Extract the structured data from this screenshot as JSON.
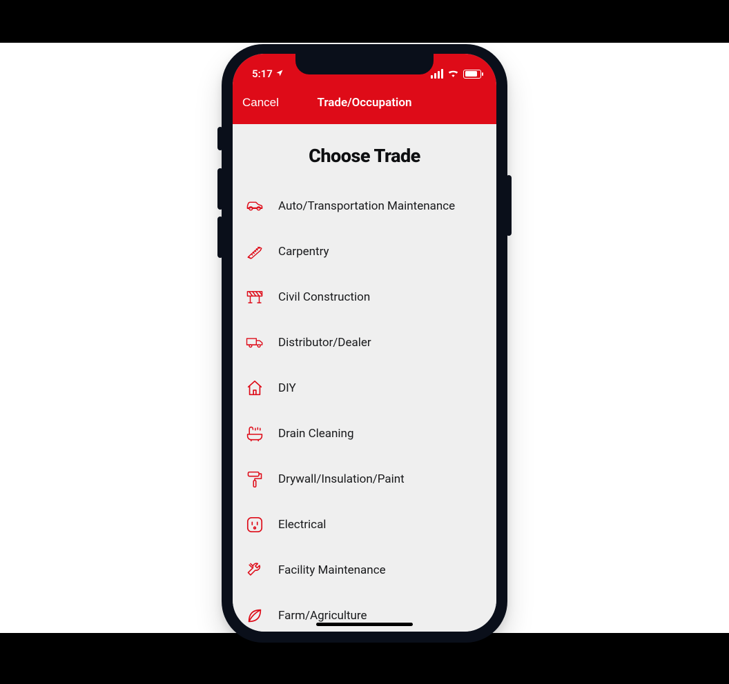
{
  "status": {
    "time": "5:17"
  },
  "nav": {
    "cancel": "Cancel",
    "title": "Trade/Occupation"
  },
  "page": {
    "heading": "Choose Trade"
  },
  "trades": [
    {
      "id": "auto",
      "label": "Auto/Transportation Maintenance"
    },
    {
      "id": "carpentry",
      "label": "Carpentry"
    },
    {
      "id": "civil",
      "label": "Civil Construction"
    },
    {
      "id": "distributor",
      "label": "Distributor/Dealer"
    },
    {
      "id": "diy",
      "label": "DIY"
    },
    {
      "id": "drain",
      "label": "Drain Cleaning"
    },
    {
      "id": "drywall",
      "label": "Drywall/Insulation/Paint"
    },
    {
      "id": "electrical",
      "label": "Electrical"
    },
    {
      "id": "facility",
      "label": "Facility Maintenance"
    },
    {
      "id": "farm",
      "label": "Farm/Agriculture"
    }
  ]
}
